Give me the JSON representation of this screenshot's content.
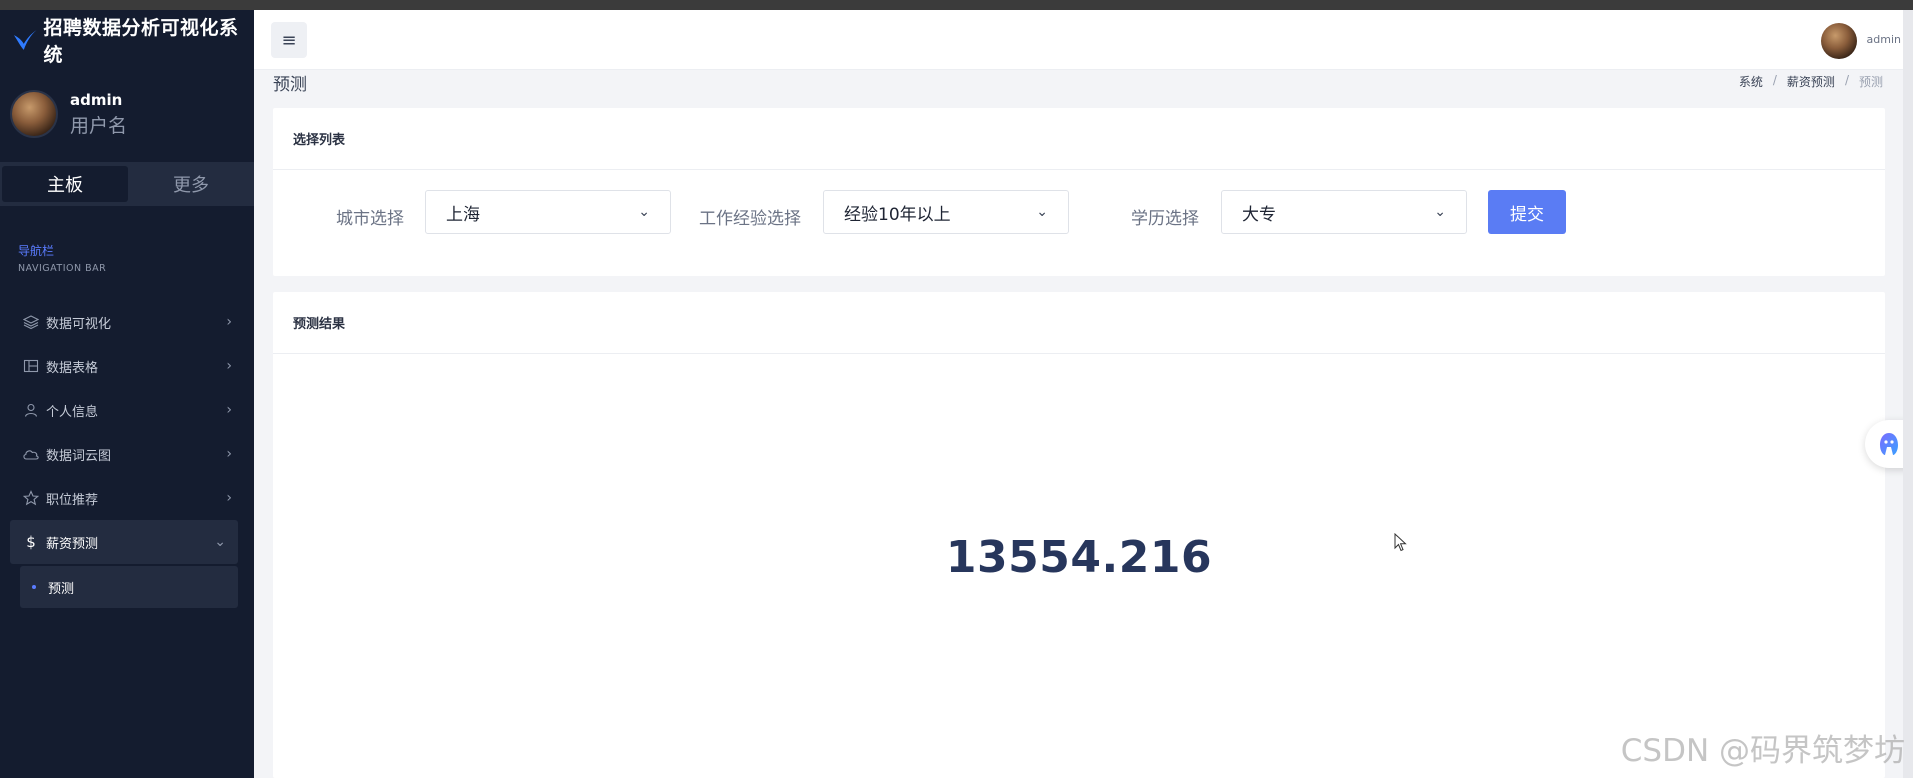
{
  "brand": {
    "title": "招聘数据分析可视化系统"
  },
  "user": {
    "name": "admin",
    "role": "用户名"
  },
  "sidebar_tabs": [
    {
      "label": "主板"
    },
    {
      "label": "更多"
    }
  ],
  "nav_header": {
    "cn": "导航栏",
    "en": "NAVIGATION BAR"
  },
  "menu": [
    {
      "label": "数据可视化",
      "icon": "layers-icon"
    },
    {
      "label": "数据表格",
      "icon": "table-icon"
    },
    {
      "label": "个人信息",
      "icon": "user-icon"
    },
    {
      "label": "数据词云图",
      "icon": "cloud-icon"
    },
    {
      "label": "职位推荐",
      "icon": "star-icon"
    },
    {
      "label": "薪资预测",
      "icon": "dollar-icon"
    }
  ],
  "submenu": {
    "label": "预测"
  },
  "topbar": {
    "username": "admin"
  },
  "page": {
    "title": "预测"
  },
  "breadcrumb": [
    "系统",
    "薪资预测",
    "预测"
  ],
  "select_card": {
    "title": "选择列表",
    "city": {
      "label": "城市选择",
      "value": "上海"
    },
    "experience": {
      "label": "工作经验选择",
      "value": "经验10年以上"
    },
    "education": {
      "label": "学历选择",
      "value": "大专"
    },
    "submit_label": "提交"
  },
  "result_card": {
    "title": "预测结果",
    "value": "13554.216"
  },
  "watermark": "CSDN @码界筑梦坊",
  "colors": {
    "sidebar_bg": "#141c2f",
    "accent": "#5a7cf4",
    "result_text": "#27365c"
  }
}
